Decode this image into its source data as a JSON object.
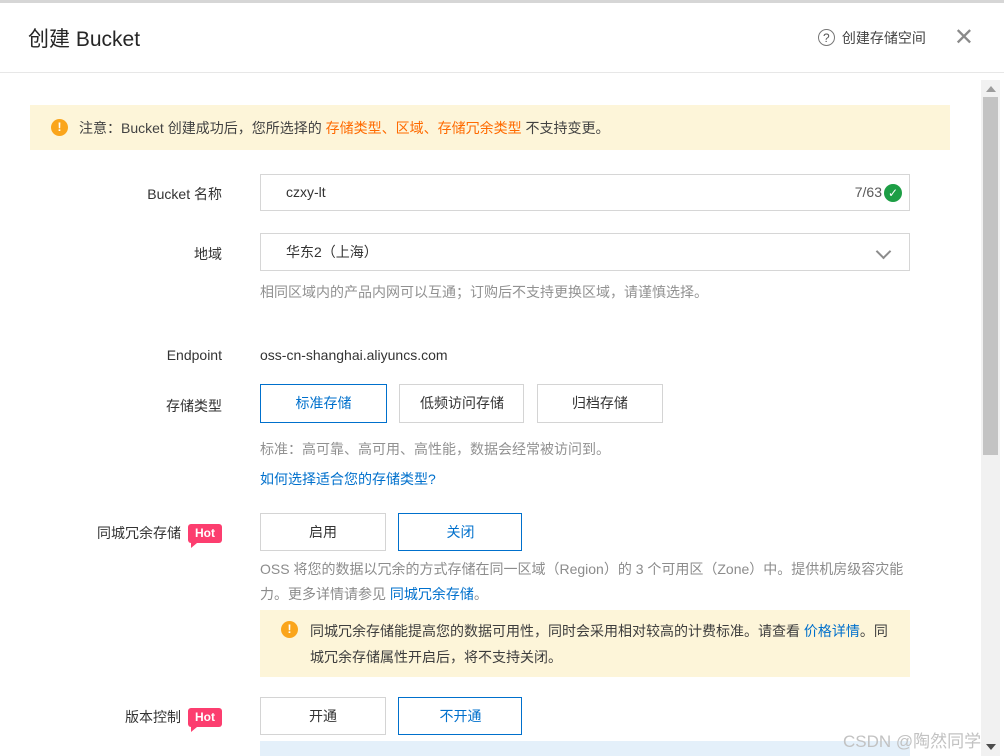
{
  "colors": {
    "accent_blue": "#0070cc",
    "highlight_orange": "#ff6a00",
    "notice_bg": "#fdf5d9",
    "hot_badge": "#fc3e6f",
    "success_green": "#1d9e45"
  },
  "header": {
    "title": "创建 Bucket",
    "help_icon": "?",
    "help_link": "创建存储空间",
    "close_icon": "✕"
  },
  "notice": {
    "icon": "!",
    "text_before": "注意：Bucket 创建成功后，您所选择的 ",
    "highlight": "存储类型、区域、存储冗余类型",
    "text_after": " 不支持变更。"
  },
  "form": {
    "bucket_name": {
      "label": "Bucket 名称",
      "value": "czxy-lt",
      "counter": "7/63",
      "valid_icon": "✓"
    },
    "region": {
      "label": "地域",
      "value": "华东2（上海）",
      "helper": "相同区域内的产品内网可以互通；订购后不支持更换区域，请谨慎选择。"
    },
    "endpoint": {
      "label": "Endpoint",
      "value": "oss-cn-shanghai.aliyuncs.com"
    },
    "storage_class": {
      "label": "存储类型",
      "options": [
        "标准存储",
        "低频访问存储",
        "归档存储"
      ],
      "selected": "标准存储",
      "helper": "标准：高可靠、高可用、高性能，数据会经常被访问到。",
      "link": "如何选择适合您的存储类型?"
    },
    "zrs": {
      "label": "同城冗余存储",
      "badge": "Hot",
      "options": [
        "启用",
        "关闭"
      ],
      "selected": "关闭",
      "desc_before": "OSS 将您的数据以冗余的方式存储在同一区域（Region）的 3 个可用区（Zone）中。提供机房级容灾能力。更多详情请参见 ",
      "desc_link": "同城冗余存储",
      "desc_after": "。",
      "warning": {
        "icon": "!",
        "text_before": "同城冗余存储能提高您的数据可用性，同时会采用相对较高的计费标准。请查看 ",
        "link": "价格详情",
        "text_after": "。同城冗余存储属性开启后，将不支持关闭。"
      }
    },
    "versioning": {
      "label": "版本控制",
      "badge": "Hot",
      "options": [
        "开通",
        "不开通"
      ],
      "selected": "不开通"
    }
  },
  "watermark": "CSDN @陶然同学"
}
